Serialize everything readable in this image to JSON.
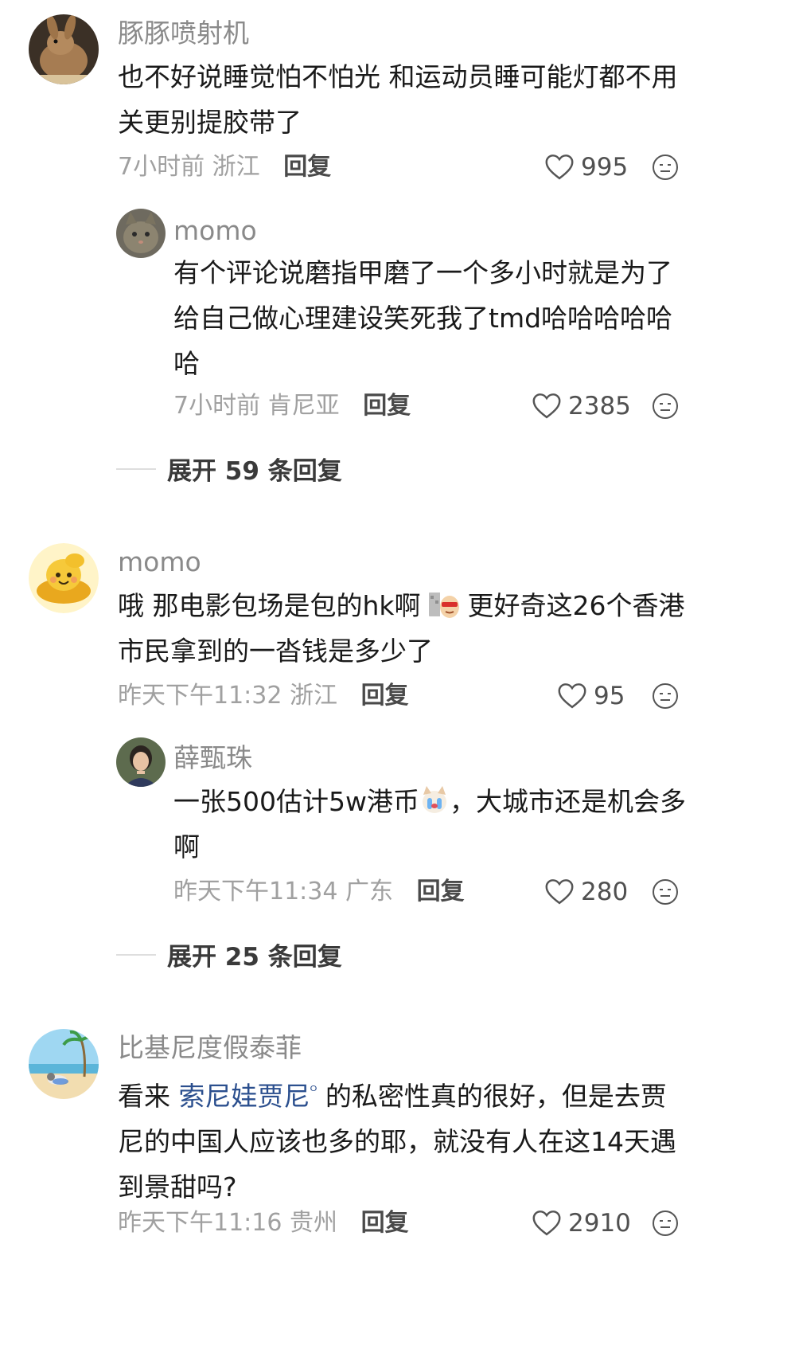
{
  "comments": [
    {
      "author": "豚豚喷射机",
      "text_lines": [
        "也不好说睡觉怕不怕光 和运动员睡可能灯都不用",
        "关更别提胶带了"
      ],
      "time": "7小时前",
      "location": "浙江",
      "reply_label": "回复",
      "likes": "995",
      "avatar_icon": "rabbit-avatar",
      "replies": [
        {
          "author": "momo",
          "text_lines": [
            "有个评论说磨指甲磨了一个多小时就是为了",
            "给自己做心理建设笑死我了tmd哈哈哈哈哈",
            "哈"
          ],
          "time": "7小时前",
          "location": "肯尼亚",
          "reply_label": "回复",
          "likes": "2385",
          "avatar_icon": "cat-avatar"
        }
      ],
      "expand_label": "展开 59 条回复"
    },
    {
      "author": "momo",
      "text_line1_a": "哦 那电影包场是包的hk啊",
      "text_line1_b": "更好奇这26个香港",
      "text_line2": "市民拿到的一沓钱是多少了",
      "time": "昨天下午11:32",
      "location": "浙江",
      "reply_label": "回复",
      "likes": "95",
      "avatar_icon": "gold-ingot-avatar",
      "replies": [
        {
          "author": "薛甄珠",
          "text_line1_a": "一张500估计5w港币",
          "text_line1_b": "，大城市还是机会多",
          "text_line2": "啊",
          "time": "昨天下午11:34",
          "location": "广东",
          "reply_label": "回复",
          "likes": "280",
          "avatar_icon": "woman-avatar"
        }
      ],
      "expand_label": "展开 25 条回复"
    },
    {
      "author": "比基尼度假泰菲",
      "text_line1_a": "看来",
      "text_line1_link": "索尼娃贾尼",
      "text_line1_b": "的私密性真的很好，但是去贾",
      "text_line2": "尼的中国人应该也多的耶，就没有人在这14天遇",
      "text_line3": "到景甜吗?",
      "time": "昨天下午11:16",
      "location": "贵州",
      "reply_label": "回复",
      "likes": "2910",
      "avatar_icon": "beach-avatar"
    }
  ],
  "colors": {
    "author": "#8a8a8a",
    "meta": "#a0a0a0",
    "link": "#2b4f8e"
  }
}
